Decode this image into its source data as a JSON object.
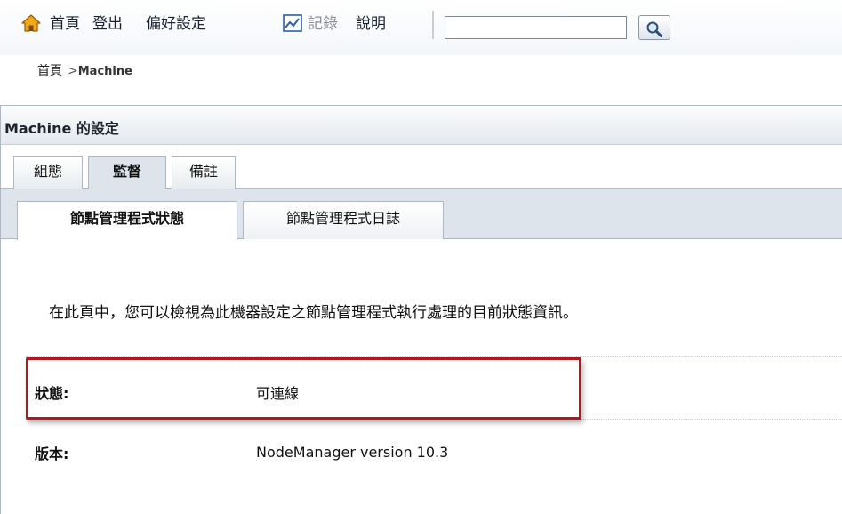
{
  "toolbar": {
    "home_label": "首頁",
    "logout_label": "登出",
    "preferences_label": "偏好設定",
    "record_label": "記錄",
    "help_label": "說明",
    "search_placeholder": "",
    "search_value": ""
  },
  "breadcrumb": {
    "home": "首頁",
    "separator": ">",
    "current": "Machine"
  },
  "panel": {
    "title": "Machine 的設定",
    "tabs": [
      {
        "label": "組態",
        "active": false
      },
      {
        "label": "監督",
        "active": true
      },
      {
        "label": "備註",
        "active": false
      }
    ],
    "subtabs": [
      {
        "label": "節點管理程式狀態",
        "active": true
      },
      {
        "label": "節點管理程式日誌",
        "active": false
      }
    ],
    "intro": "在此頁中，您可以檢視為此機器設定之節點管理程式執行處理的目前狀態資訊。",
    "fields": {
      "status": {
        "label": "狀態:",
        "value": "可連線"
      },
      "version": {
        "label": "版本:",
        "value": "NodeManager version 10.3"
      }
    }
  },
  "colors": {
    "highlight_border": "#b3171d",
    "active_subtab_bg": "#dde4ec",
    "home_icon": "#e8a10c"
  },
  "icons": [
    "home-icon",
    "record-icon",
    "search-icon"
  ]
}
